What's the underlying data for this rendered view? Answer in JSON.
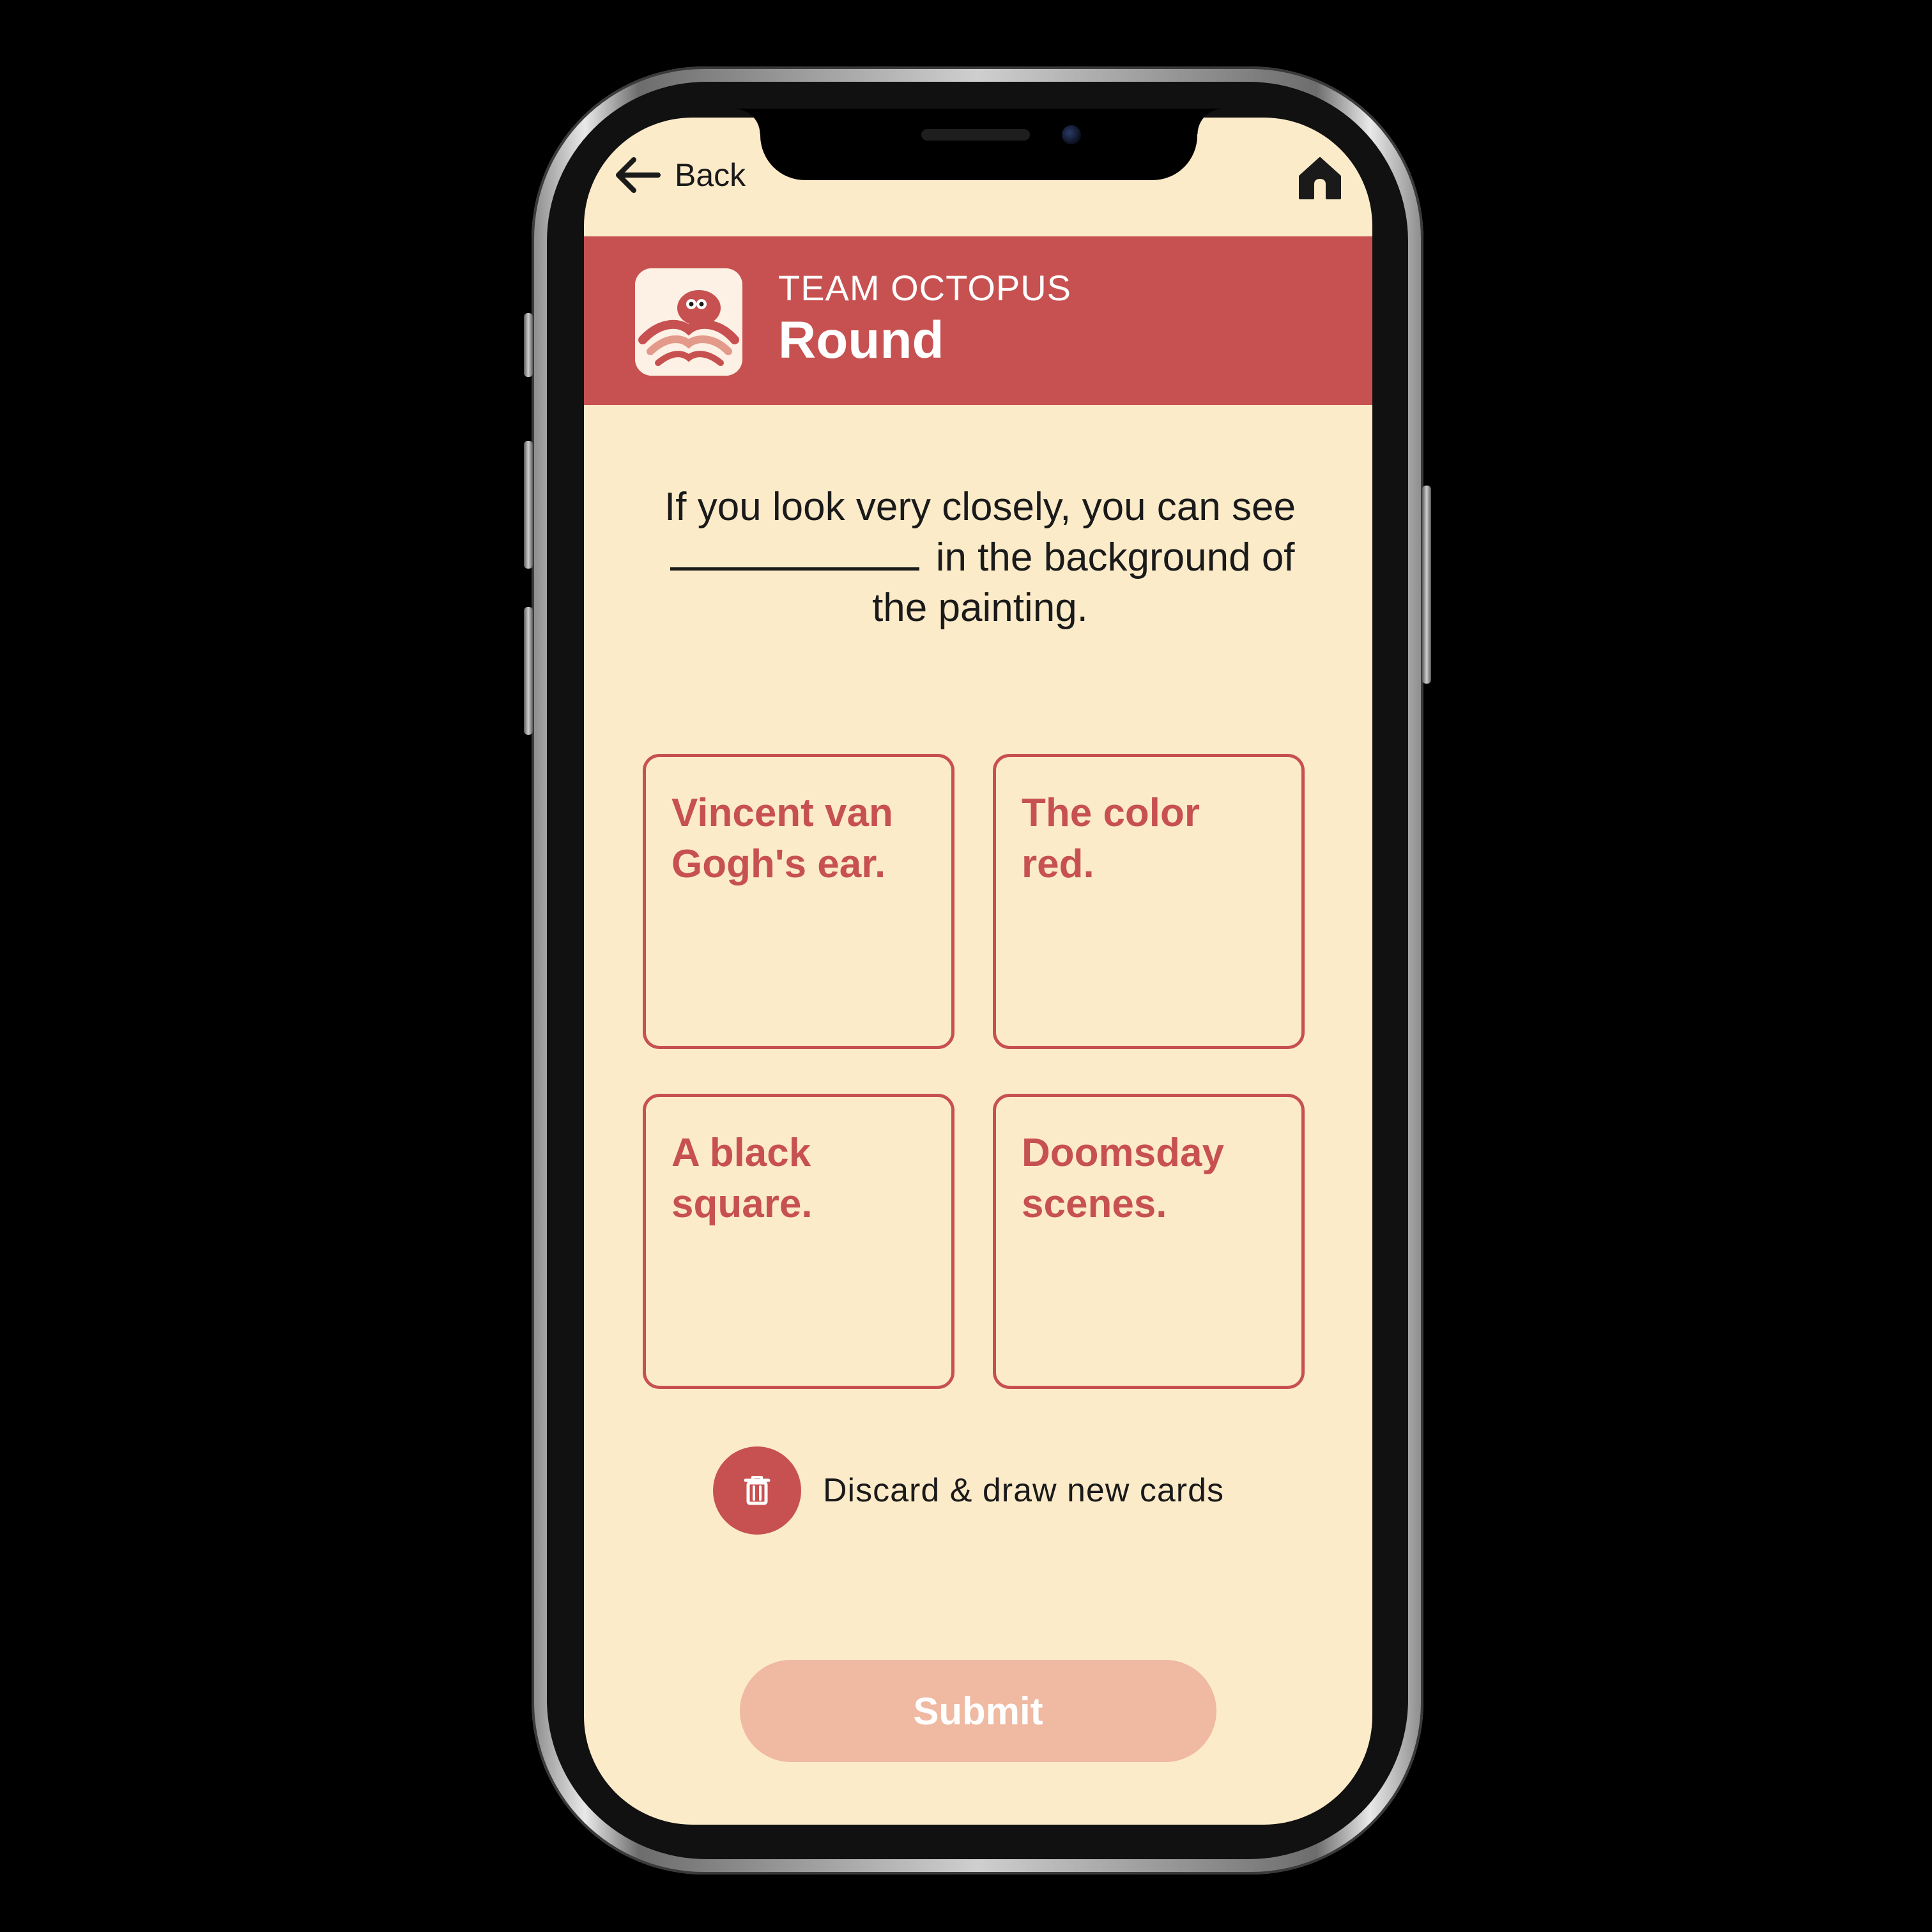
{
  "nav": {
    "back_label": "Back",
    "back_icon": "arrow-left-icon",
    "home_icon": "home-icon"
  },
  "header": {
    "team_name": "TEAM OCTOPUS",
    "title": "Round",
    "avatar_icon": "octopus-icon"
  },
  "prompt": {
    "line_before_blank": "If you look very closely, you can see",
    "line_after_blank": "in the background of the painting."
  },
  "cards": [
    {
      "text": "Vincent van Gogh's ear."
    },
    {
      "text": "The color red."
    },
    {
      "text": "A black square."
    },
    {
      "text": "Doomsday scenes."
    }
  ],
  "discard": {
    "label": "Discard & draw new cards",
    "icon": "trash-icon"
  },
  "submit": {
    "label": "Submit"
  },
  "colors": {
    "background": "#fcebc9",
    "accent": "#c75150",
    "submit_disabled": "#efb9a2",
    "text": "#1a1a1a"
  }
}
